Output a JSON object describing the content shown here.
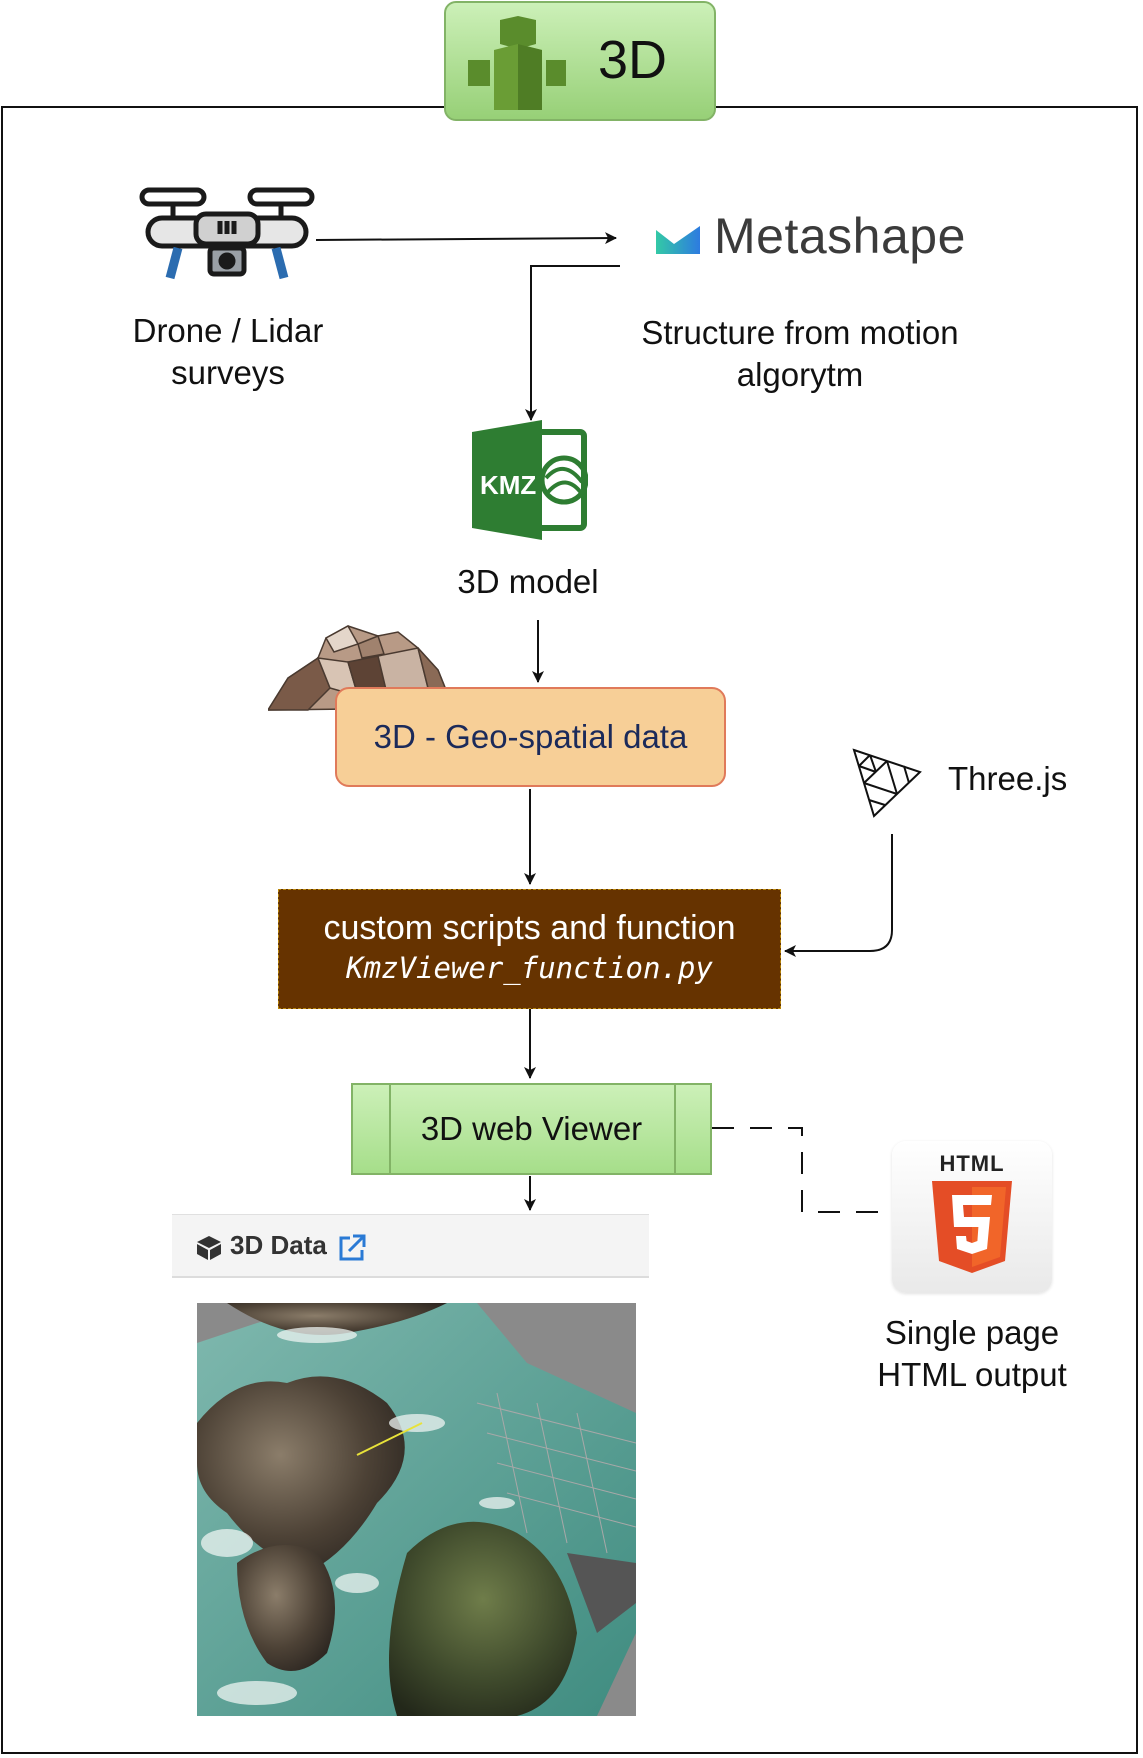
{
  "title": "3D",
  "colors": {
    "title_fill": "#97d077",
    "geo_fill": "#f7cf97",
    "geo_border": "#e07a5a",
    "scripts_fill": "#663300",
    "viewer_fill": "#b9e6a0",
    "kmz_green": "#2e7d32",
    "html5_orange": "#e44d26"
  },
  "nodes": {
    "drone_label": [
      "Drone / Lidar",
      "surveys"
    ],
    "metashape_logo": "Metashape",
    "metashape_label": [
      "Structure from motion",
      "algorytm"
    ],
    "kmz_icon_text": "KMZ",
    "kmz_label": "3D model",
    "geo_box": "3D - Geo-spatial data",
    "threejs_label": "Three.js",
    "scripts_title": "custom scripts and function",
    "scripts_file": "KmzViewer_function.py",
    "viewer_box": "3D web Viewer",
    "html5_icon_text": "HTML",
    "html5_label": [
      "Single page",
      "HTML output"
    ],
    "panel_title": "3D Data"
  },
  "icons": [
    "drone-icon",
    "metashape-icon",
    "kmz-file-icon",
    "terrain-icon",
    "threejs-icon",
    "html5-icon",
    "cube-icon",
    "external-link-icon"
  ]
}
